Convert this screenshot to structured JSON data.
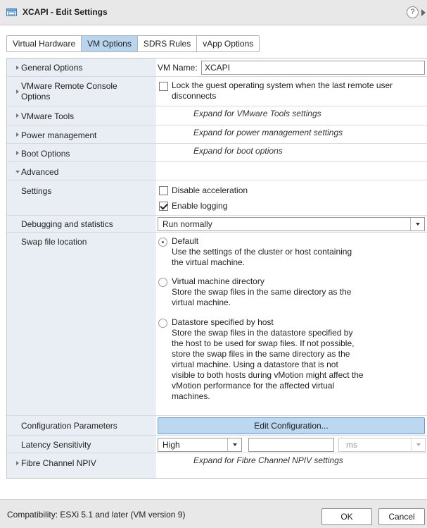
{
  "window": {
    "title": "XCAPI - Edit Settings",
    "help": "?"
  },
  "tabs": [
    {
      "label": "Virtual Hardware",
      "active": false
    },
    {
      "label": "VM Options",
      "active": true
    },
    {
      "label": "SDRS Rules",
      "active": false
    },
    {
      "label": "vApp Options",
      "active": false
    }
  ],
  "general": {
    "label": "General Options",
    "vm_name_label": "VM Name:",
    "vm_name_value": "XCAPI"
  },
  "vmrc": {
    "label_line1": "VMware Remote Console",
    "label_line2": "Options",
    "lock_line1": "Lock the guest operating system when the last remote user",
    "lock_line2": "disconnects",
    "lock_checked": false
  },
  "tools": {
    "label": "VMware Tools",
    "hint": "Expand for VMware Tools settings"
  },
  "power": {
    "label": "Power management",
    "hint": "Expand for power management settings"
  },
  "boot": {
    "label": "Boot Options",
    "hint": "Expand for boot options"
  },
  "advanced": {
    "label": "Advanced",
    "settings": {
      "label": "Settings",
      "disable_accel": {
        "label": "Disable acceleration",
        "checked": false
      },
      "enable_logging": {
        "label": "Enable logging",
        "checked": true
      }
    },
    "debug": {
      "label": "Debugging and statistics",
      "value": "Run normally"
    },
    "swap": {
      "label": "Swap file location",
      "options": [
        {
          "title": "Default",
          "selected": true,
          "lines": [
            "Use the settings of the cluster or host containing",
            "the virtual machine."
          ]
        },
        {
          "title": "Virtual machine directory",
          "selected": false,
          "lines": [
            "Store the swap files in the same directory as the",
            "virtual machine."
          ]
        },
        {
          "title": "Datastore specified by host",
          "selected": false,
          "lines": [
            "Store the swap files in the datastore specified by",
            "the host to be used for swap files. If not possible,",
            "store the swap files in the same directory as the",
            "virtual machine. Using a datastore that is not",
            "visible to both hosts during vMotion might affect the",
            "vMotion performance for the affected virtual",
            "machines."
          ]
        }
      ]
    },
    "config": {
      "label": "Configuration Parameters",
      "button": "Edit Configuration..."
    },
    "latency": {
      "label": "Latency Sensitivity",
      "value": "High",
      "input_value": "",
      "unit": "ms"
    }
  },
  "fibre": {
    "label": "Fibre Channel NPIV",
    "hint": "Expand for Fibre Channel NPIV settings"
  },
  "footer": {
    "compat": "Compatibility: ESXi 5.1 and later (VM version 9)",
    "ok": "OK",
    "cancel": "Cancel"
  }
}
